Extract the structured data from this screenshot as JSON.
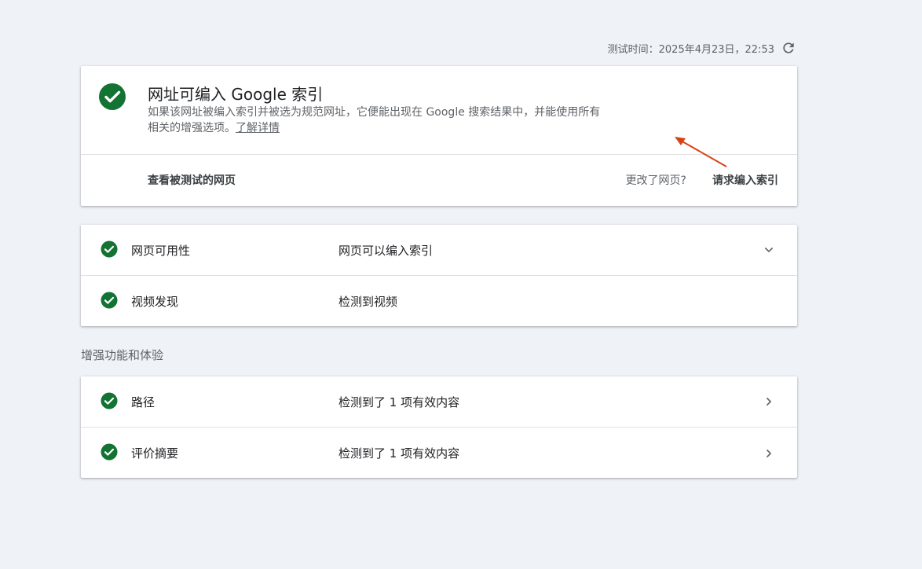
{
  "header": {
    "test_time": "测试时间：2025年4月23日，22:53",
    "refresh_icon": "refresh-icon"
  },
  "status": {
    "title": "网址可编入 Google 索引",
    "description": "如果该网址被编入索引并被选为规范网址，它便能出现在 Google 搜索结果中，并能使用所有相关的增强选项。",
    "learn_more": "了解详情",
    "view_tested_page": "查看被测试的网页",
    "page_changed": "更改了网页?",
    "request_indexing": "请求编入索引",
    "status_color": "#137333"
  },
  "checks": [
    {
      "name": "网页可用性",
      "value": "网页可以编入索引",
      "action_icon": "chevron-down-icon"
    },
    {
      "name": "视频发现",
      "value": "检测到视频"
    }
  ],
  "enhancements": {
    "title": "增强功能和体验",
    "items": [
      {
        "name": "路径",
        "value": "检测到了 1 项有效内容",
        "action_icon": "chevron-right-icon"
      },
      {
        "name": "评价摘要",
        "value": "检测到了 1 项有效内容",
        "action_icon": "chevron-right-icon"
      }
    ]
  },
  "annotation": {
    "arrow_color": "#d84315"
  }
}
